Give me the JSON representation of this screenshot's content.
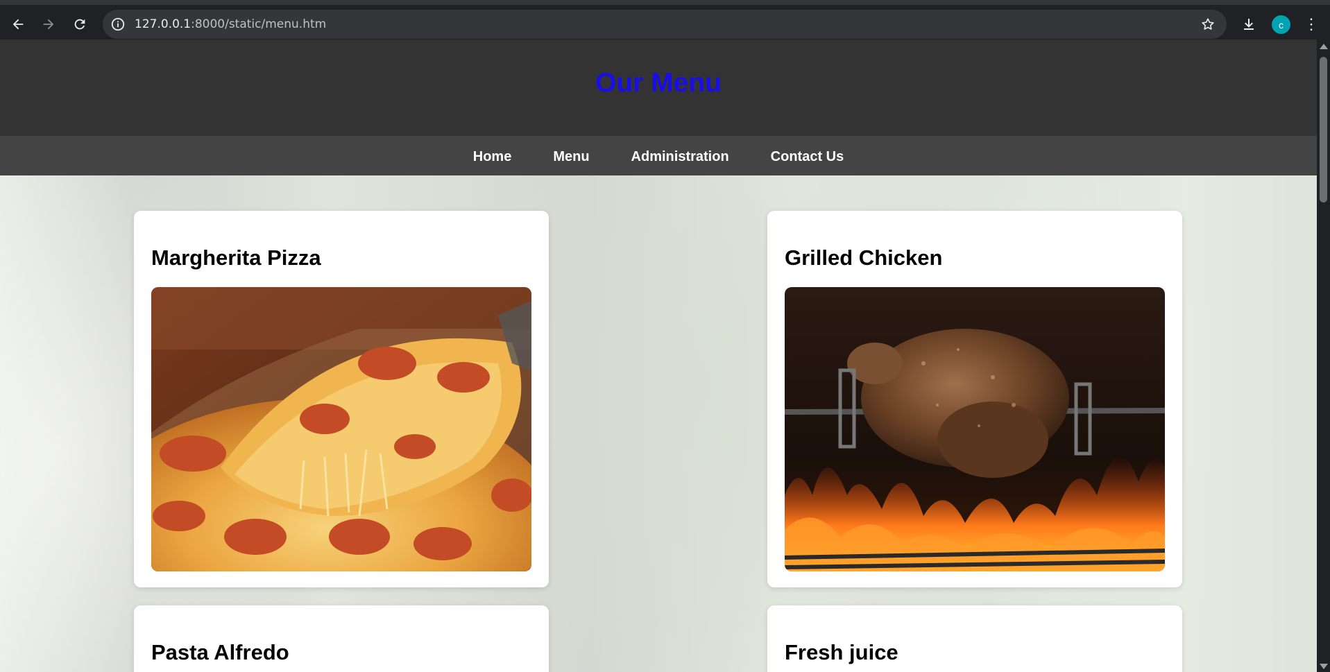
{
  "browser": {
    "url_host": "127.0.0.1",
    "url_path": ":8000/static/menu.htm",
    "profile_initial": "c",
    "icons": [
      "back-icon",
      "forward-icon",
      "reload-icon",
      "site-info-icon",
      "bookmark-star-icon",
      "download-icon",
      "kebab-menu-icon"
    ],
    "accent": "#00a3b4"
  },
  "header": {
    "title": "Our Menu",
    "title_color": "#1a0ee8"
  },
  "nav": {
    "items": [
      "Home",
      "Menu",
      "Administration",
      "Contact Us"
    ]
  },
  "menu": {
    "items": [
      {
        "name": "Margherita Pizza"
      },
      {
        "name": "Grilled Chicken"
      },
      {
        "name": "Pasta Alfredo"
      },
      {
        "name": "Fresh juice"
      }
    ]
  }
}
